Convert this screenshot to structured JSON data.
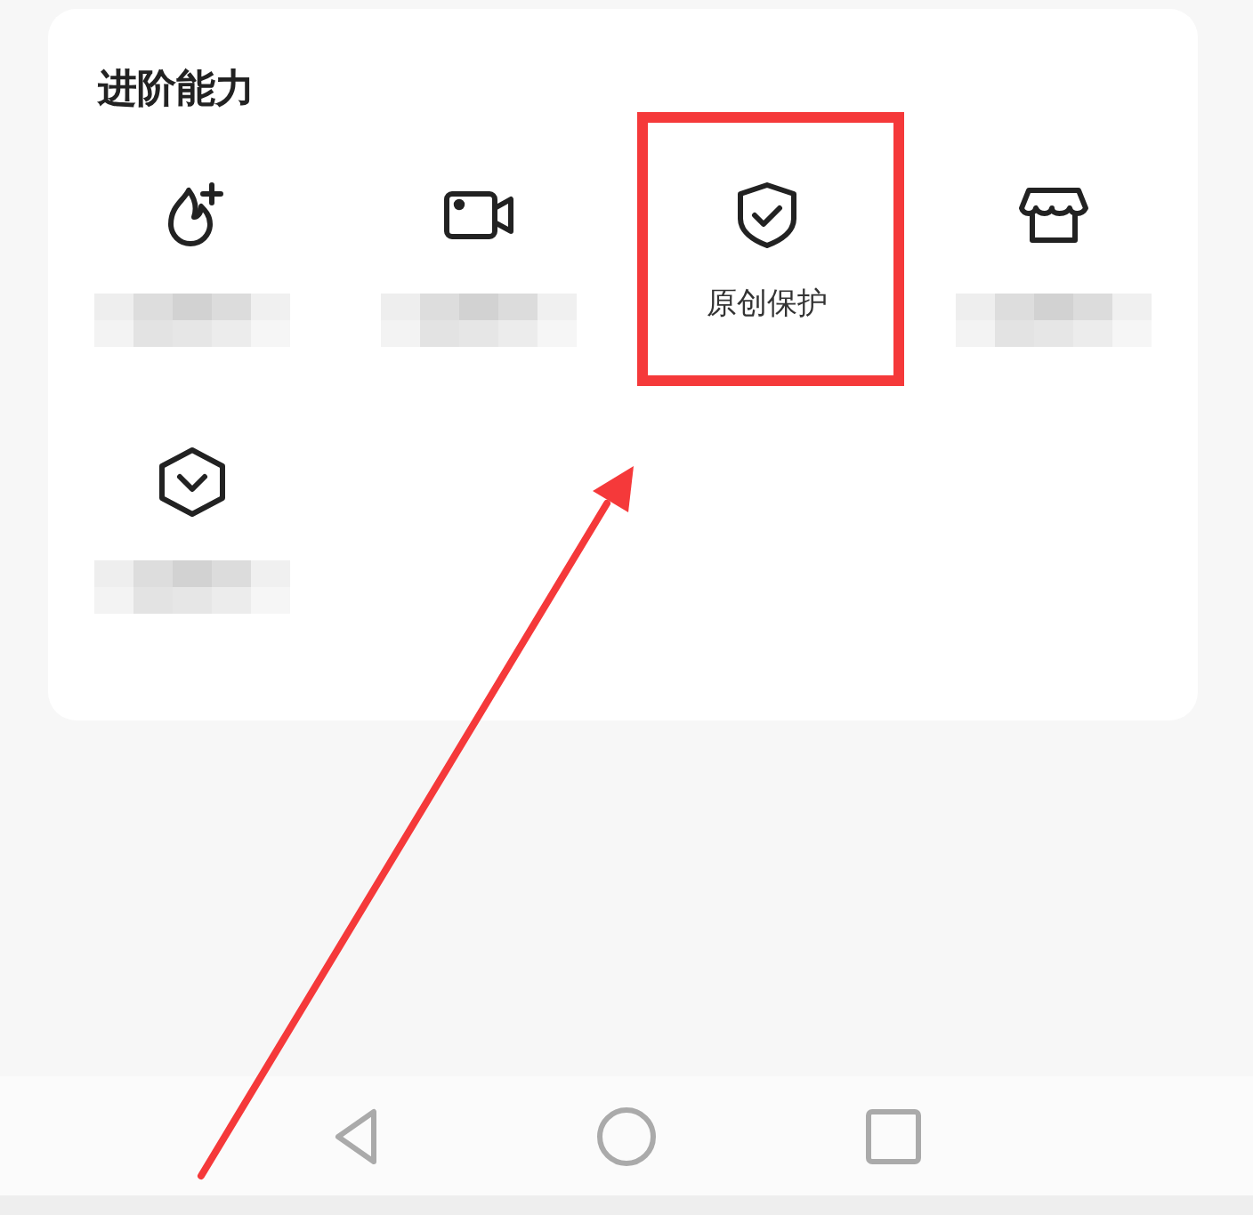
{
  "section": {
    "title": "进阶能力",
    "items": [
      {
        "kind": "flame-plus",
        "blurred": true,
        "highlighted": false
      },
      {
        "kind": "camera",
        "blurred": true,
        "highlighted": false
      },
      {
        "kind": "shield-check",
        "label": "原创保护",
        "blurred": false,
        "highlighted": true
      },
      {
        "kind": "shop",
        "blurred": true,
        "highlighted": false
      },
      {
        "kind": "hexagon-down",
        "blurred": true,
        "highlighted": false
      }
    ]
  },
  "nav_bar": {
    "buttons": [
      {
        "kind": "back"
      },
      {
        "kind": "home"
      },
      {
        "kind": "recents"
      }
    ]
  }
}
